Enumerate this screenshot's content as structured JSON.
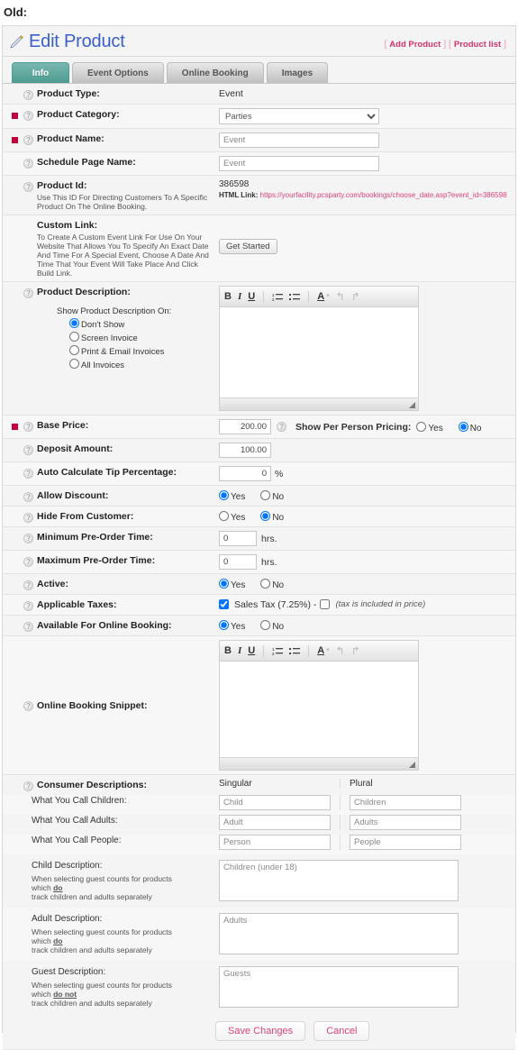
{
  "page_label": "Old:",
  "header": {
    "title": "Edit Product",
    "icon": "edit-pencil-icon",
    "links": [
      {
        "label": "Add Product"
      },
      {
        "label": "Product list"
      }
    ],
    "bracket_open": "[",
    "bracket_close": "]",
    "title_color": "#3a5fcd",
    "link_color": "#d6336c"
  },
  "tabs": [
    {
      "label": "Info",
      "active": true
    },
    {
      "label": "Event Options",
      "active": false
    },
    {
      "label": "Online Booking",
      "active": false
    },
    {
      "label": "Images",
      "active": false
    }
  ],
  "tab_active_color": "#4e9b91",
  "required_marker_color": "#c4003c",
  "fields": {
    "product_type": {
      "label": "Product Type:",
      "value": "Event"
    },
    "product_category": {
      "label": "Product Category:",
      "value": "Parties",
      "options": [
        "Parties"
      ]
    },
    "product_name": {
      "label": "Product Name:",
      "value": "Event"
    },
    "schedule_page_name": {
      "label": "Schedule Page Name:",
      "value": "Event"
    },
    "product_id": {
      "label": "Product Id:",
      "sub": "Use This ID For Directing Customers To A Specific Product On The Online Booking.",
      "value": "386598",
      "html_link_label": "HTML Link:",
      "html_link_url": "https://yourfacility.pcsparty.com/bookings/choose_date.asp?event_id=386598"
    },
    "custom_link": {
      "label": "Custom Link:",
      "sub": "To Create A Custom Event Link For Use On Your Website That Allows You To Specify An Exact Date And Time For A Special Event, Choose A Date And Time That Your Event Will Take Place And Click Build Link.",
      "button": "Get Started"
    },
    "product_description": {
      "label": "Product Description:",
      "show_on_label": "Show Product Description On:",
      "options": [
        {
          "label": "Don't Show",
          "selected": true
        },
        {
          "label": "Screen Invoice",
          "selected": false
        },
        {
          "label": "Print & Email Invoices",
          "selected": false
        },
        {
          "label": "All Invoices",
          "selected": false
        }
      ],
      "body": ""
    },
    "base_price": {
      "label": "Base Price:",
      "value": "200.00",
      "per_person_label": "Show Per Person Pricing:",
      "per_person_yes": "Yes",
      "per_person_no": "No",
      "per_person_value": "No"
    },
    "deposit_amount": {
      "label": "Deposit Amount:",
      "value": "100.00"
    },
    "tip_percentage": {
      "label": "Auto Calculate Tip Percentage:",
      "value": "0",
      "unit": "%"
    },
    "allow_discount": {
      "label": "Allow Discount:",
      "yes": "Yes",
      "no": "No",
      "value": "Yes"
    },
    "hide_from_customer": {
      "label": "Hide From Customer:",
      "yes": "Yes",
      "no": "No",
      "value": "No"
    },
    "min_preorder": {
      "label": "Minimum Pre-Order Time:",
      "value": "0",
      "unit": "hrs."
    },
    "max_preorder": {
      "label": "Maximum Pre-Order Time:",
      "value": "0",
      "unit": "hrs."
    },
    "active": {
      "label": "Active:",
      "yes": "Yes",
      "no": "No",
      "value": "Yes"
    },
    "applicable_taxes": {
      "label": "Applicable Taxes:",
      "tax_label": "Sales Tax (7.25%) -",
      "tax_checked": true,
      "included_label": "(tax is included in price)",
      "included_checked": false
    },
    "available_online": {
      "label": "Available For Online Booking:",
      "yes": "Yes",
      "no": "No",
      "value": "Yes"
    },
    "online_booking_snippet": {
      "label": "Online Booking Snippet:",
      "body": ""
    },
    "consumer_descriptions": {
      "label": "Consumer Descriptions:",
      "col_singular": "Singular",
      "col_plural": "Plural",
      "rows": [
        {
          "label": "What You Call Children:",
          "singular": "Child",
          "plural": "Children"
        },
        {
          "label": "What You Call Adults:",
          "singular": "Adult",
          "plural": "Adults"
        },
        {
          "label": "What You Call People:",
          "singular": "Person",
          "plural": "People"
        }
      ],
      "child_description": {
        "label": "Child Description:",
        "help_1": "When selecting guest counts for products",
        "help_2": "which ",
        "help_emphasis": "do",
        "help_3": "track children and adults separately",
        "value": "Children (under 18)"
      },
      "adult_description": {
        "label": "Adult Description:",
        "help_1": "When selecting guest counts for products",
        "help_2": "which ",
        "help_emphasis": "do",
        "help_3": "track children and adults separately",
        "value": "Adults"
      },
      "guest_description": {
        "label": "Guest Description:",
        "help_1": "When selecting guest counts for products",
        "help_2": "which ",
        "help_emphasis": "do not",
        "help_3": "track children and adults separately",
        "value": "Guests"
      }
    }
  },
  "editor_toolbar": {
    "bold": "B",
    "italic": "I",
    "underline": "U",
    "ordered_list": "ordered-list-icon",
    "bullet_list": "bullet-list-icon",
    "font_color": "A",
    "font_color_caret": "▾",
    "undo": "↰",
    "redo": "↱"
  },
  "footer": {
    "save_label": "Save Changes",
    "cancel_label": "Cancel"
  }
}
